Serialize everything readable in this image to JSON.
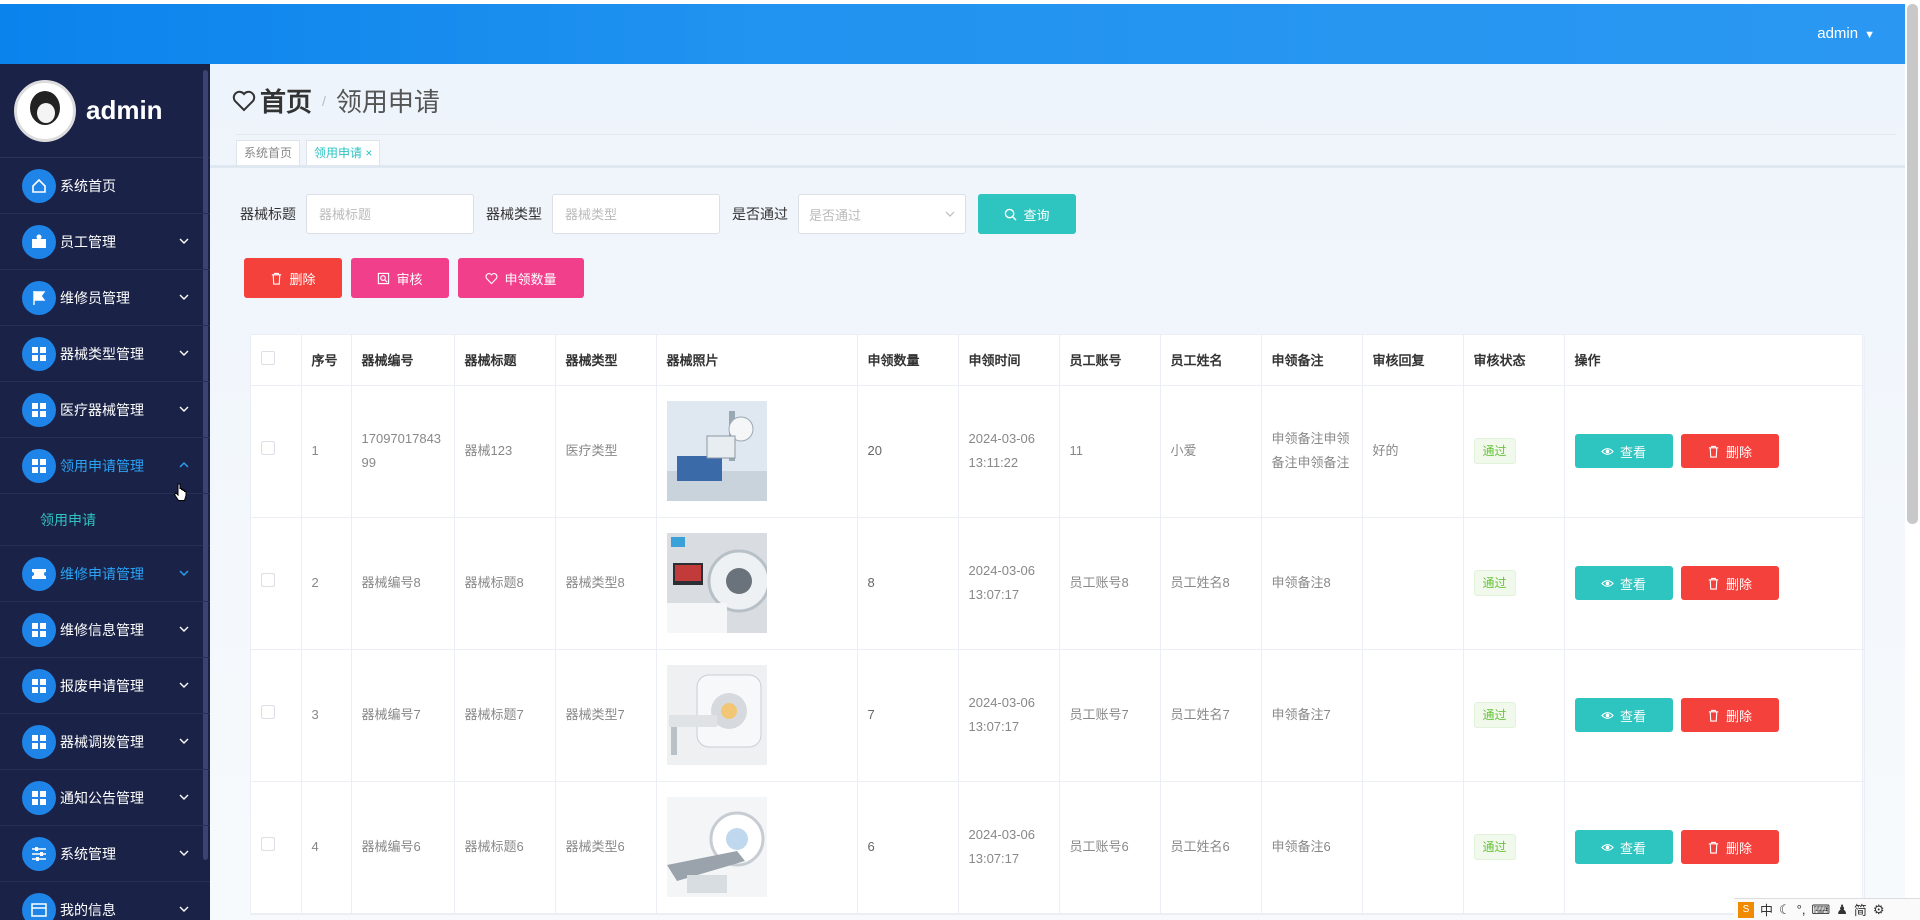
{
  "colors": {
    "topbar": "#1589ee",
    "sidebar": "#1a2247",
    "accent": "#2ec4c0",
    "danger": "#f5413c",
    "pink": "#f23f8c"
  },
  "topbar": {
    "user": "admin"
  },
  "sidebar": {
    "profile_name": "admin",
    "items": [
      {
        "label": "系统首页",
        "icon": "home-icon",
        "has_chevron": false
      },
      {
        "label": "员工管理",
        "icon": "user-card-icon",
        "has_chevron": true
      },
      {
        "label": "维修员管理",
        "icon": "flag-icon",
        "has_chevron": true
      },
      {
        "label": "器械类型管理",
        "icon": "grid-icon",
        "has_chevron": true
      },
      {
        "label": "医疗器械管理",
        "icon": "grid-icon",
        "has_chevron": true
      },
      {
        "label": "领用申请管理",
        "icon": "grid-icon",
        "has_chevron": true,
        "expanded": true
      },
      {
        "label": "维修申请管理",
        "icon": "ticket-icon",
        "has_chevron": true
      },
      {
        "label": "维修信息管理",
        "icon": "grid-icon",
        "has_chevron": true
      },
      {
        "label": "报废申请管理",
        "icon": "grid-icon",
        "has_chevron": true
      },
      {
        "label": "器械调拨管理",
        "icon": "grid-icon",
        "has_chevron": true
      },
      {
        "label": "通知公告管理",
        "icon": "grid-icon",
        "has_chevron": true
      },
      {
        "label": "系统管理",
        "icon": "sliders-icon",
        "has_chevron": true
      },
      {
        "label": "我的信息",
        "icon": "card-icon",
        "has_chevron": true
      }
    ],
    "submenu": "领用申请"
  },
  "breadcrumb": {
    "home": "首页",
    "separator": "/",
    "current": "领用申请"
  },
  "tabs": [
    {
      "label": "系统首页"
    },
    {
      "label": "领用申请"
    }
  ],
  "search": {
    "title_label": "器械标题",
    "title_placeholder": "器械标题",
    "type_label": "器械类型",
    "type_placeholder": "器械类型",
    "passed_label": "是否通过",
    "passed_placeholder": "是否通过",
    "query_button": "查询"
  },
  "actions": {
    "delete": "删除",
    "audit": "审核",
    "apply_count": "申领数量"
  },
  "table": {
    "headers": [
      "序号",
      "器械编号",
      "器械标题",
      "器械类型",
      "器械照片",
      "申领数量",
      "申领时间",
      "员工账号",
      "员工姓名",
      "申领备注",
      "审核回复",
      "审核状态",
      "操作"
    ],
    "rows": [
      {
        "index": "1",
        "code": "1709701784399",
        "title": "器械123",
        "type": "医疗类型",
        "count": "20",
        "date": "2024-03-06",
        "time": "13:11:22",
        "account": "11",
        "name": "小爱",
        "remark": "申领备注申领备注申领备注",
        "reply": "好的",
        "status": "通过",
        "photo": "lab-machine"
      },
      {
        "index": "2",
        "code": "器械编号8",
        "title": "器械标题8",
        "type": "器械类型8",
        "count": "8",
        "date": "2024-03-06",
        "time": "13:07:17",
        "account": "员工账号8",
        "name": "员工姓名8",
        "remark": "申领备注8",
        "reply": "",
        "status": "通过",
        "photo": "ct-room"
      },
      {
        "index": "3",
        "code": "器械编号7",
        "title": "器械标题7",
        "type": "器械类型7",
        "count": "7",
        "date": "2024-03-06",
        "time": "13:07:17",
        "account": "员工账号7",
        "name": "员工姓名7",
        "remark": "申领备注7",
        "reply": "",
        "status": "通过",
        "photo": "mri-scanner"
      },
      {
        "index": "4",
        "code": "器械编号6",
        "title": "器械标题6",
        "type": "器械类型6",
        "count": "6",
        "date": "2024-03-06",
        "time": "13:07:17",
        "account": "员工账号6",
        "name": "员工姓名6",
        "remark": "申领备注6",
        "reply": "",
        "status": "通过",
        "photo": "ct-scanner"
      }
    ],
    "view_label": "查看",
    "delete_label": "删除"
  },
  "ime": {
    "items": [
      "中",
      "简"
    ]
  }
}
